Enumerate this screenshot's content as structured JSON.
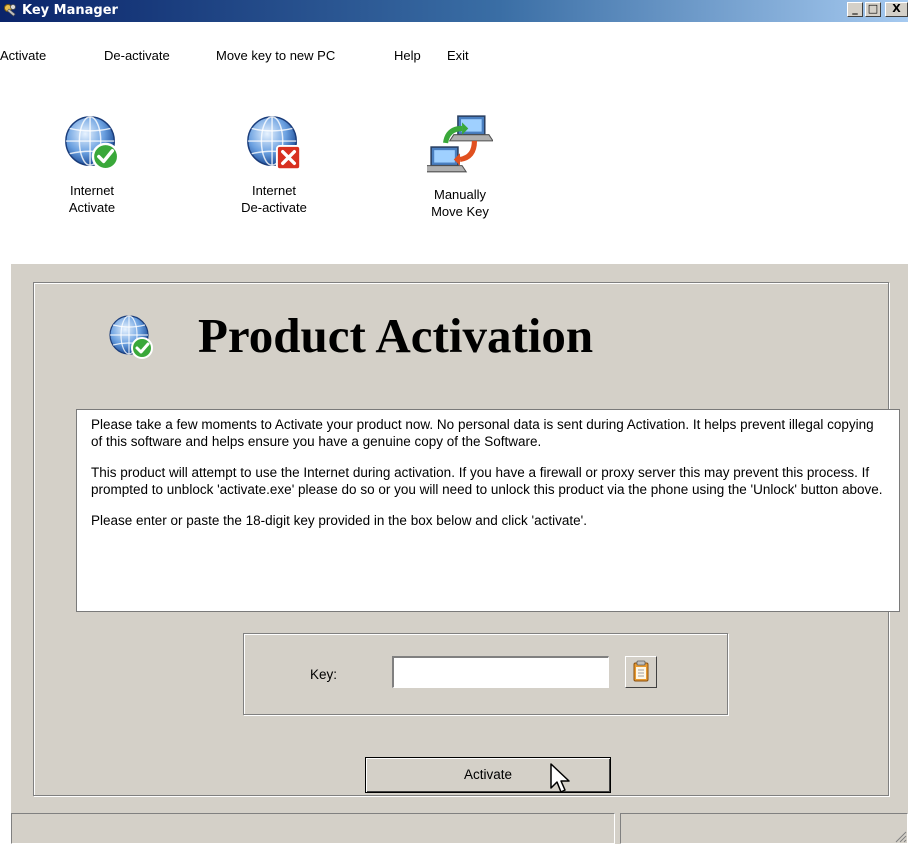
{
  "window": {
    "title": "Key Manager",
    "minimize": "_",
    "maximize": "□",
    "close": "X"
  },
  "menu": {
    "items": [
      "Activate",
      "De-activate",
      "Move key to new PC",
      "Help",
      "Exit"
    ]
  },
  "toolbar": {
    "items": [
      {
        "line1": "Internet",
        "line2": "Activate",
        "icon": "globe-check-icon"
      },
      {
        "line1": "Internet",
        "line2": "De-activate",
        "icon": "globe-x-icon"
      },
      {
        "line1": "Manually",
        "line2": "Move Key",
        "icon": "computers-transfer-icon"
      }
    ]
  },
  "main": {
    "title": "Product Activation",
    "paragraphs": [
      "Please take a few moments to Activate your product now.  No personal data is sent during Activation.  It helps prevent illegal copying of this software and helps ensure you have a genuine copy of the Software.",
      "This product will attempt to use the Internet during activation.  If you have a firewall or proxy server this may prevent this process.  If prompted to unblock 'activate.exe' please do so or you will need to unlock this product via the phone using the 'Unlock' button above.",
      "Please enter or paste the 18-digit key provided in the box below and click 'activate'."
    ],
    "key_label": "Key:",
    "key_value": "",
    "activate_label": "Activate"
  },
  "colors": {
    "titlebar_start": "#0a246a",
    "titlebar_end": "#a6caf0",
    "face": "#d4d0c8"
  }
}
